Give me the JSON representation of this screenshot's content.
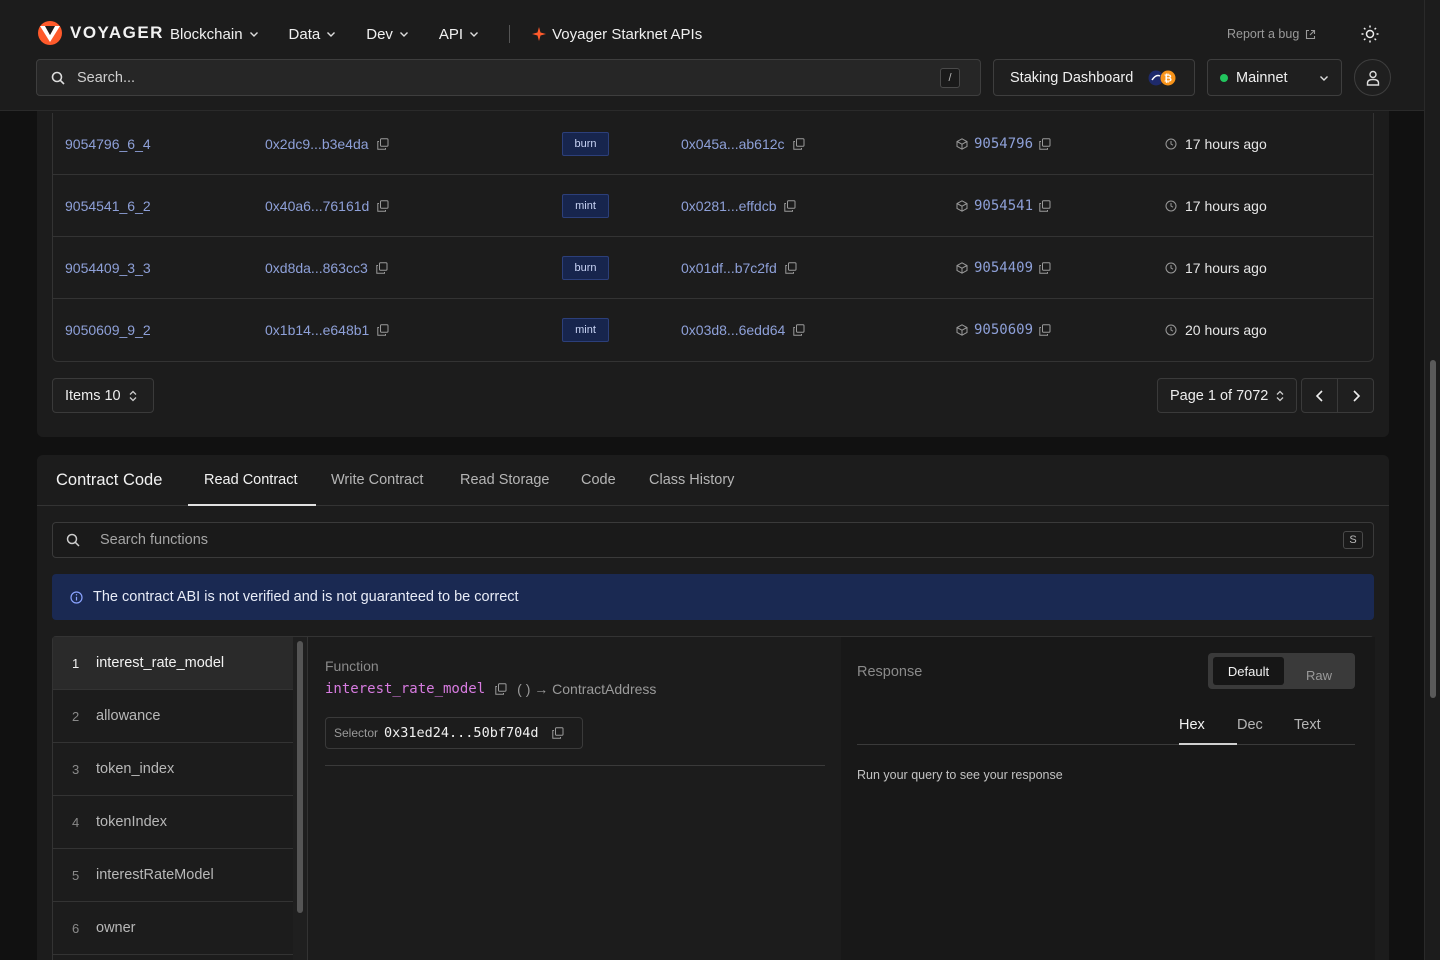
{
  "header": {
    "brand": "VOYAGER",
    "nav": [
      {
        "label": "Blockchain"
      },
      {
        "label": "Data"
      },
      {
        "label": "Dev"
      },
      {
        "label": "API"
      }
    ],
    "starknet_apis": "Voyager Starknet APIs",
    "report_bug": "Report a bug",
    "search_placeholder": "Search...",
    "search_shortcut": "/",
    "staking": "Staking Dashboard",
    "network": "Mainnet",
    "brand_color": "#ff5a2b"
  },
  "table": {
    "rows": [
      {
        "id": "9054796_6_4",
        "hash": "0x2dc9...b3e4da",
        "type": "burn",
        "from": "0x045a...ab612c",
        "block": "9054796",
        "age": "17 hours ago"
      },
      {
        "id": "9054541_6_2",
        "hash": "0x40a6...76161d",
        "type": "mint",
        "from": "0x0281...effdcb",
        "block": "9054541",
        "age": "17 hours ago"
      },
      {
        "id": "9054409_3_3",
        "hash": "0xd8da...863cc3",
        "type": "burn",
        "from": "0x01df...b7c2fd",
        "block": "9054409",
        "age": "17 hours ago"
      },
      {
        "id": "9050609_9_2",
        "hash": "0x1b14...e648b1",
        "type": "mint",
        "from": "0x03d8...6edd64",
        "block": "9050609",
        "age": "20 hours ago"
      }
    ],
    "items": "Items 10",
    "page": "Page 1 of 7072"
  },
  "contract": {
    "title": "Contract Code",
    "tabs": [
      "Read Contract",
      "Write Contract",
      "Read Storage",
      "Code",
      "Class History"
    ],
    "search_placeholder": "Search functions",
    "search_shortcut": "S",
    "alert": "The contract ABI is not verified and is not guaranteed to be correct",
    "functions": [
      {
        "num": "1",
        "name": "interest_rate_model"
      },
      {
        "num": "2",
        "name": "allowance"
      },
      {
        "num": "3",
        "name": "token_index"
      },
      {
        "num": "4",
        "name": "tokenIndex"
      },
      {
        "num": "5",
        "name": "interestRateModel"
      },
      {
        "num": "6",
        "name": "owner"
      }
    ],
    "detail": {
      "label": "Function",
      "name": "interest_rate_model",
      "signature": "( ) → ContractAddress",
      "selector_label": "Selector",
      "selector": "0x31ed24...50bf704d"
    },
    "response": {
      "label": "Response",
      "modes": [
        "Default",
        "Raw"
      ],
      "formats": [
        "Hex",
        "Dec",
        "Text"
      ],
      "empty": "Run your query to see your response"
    }
  }
}
